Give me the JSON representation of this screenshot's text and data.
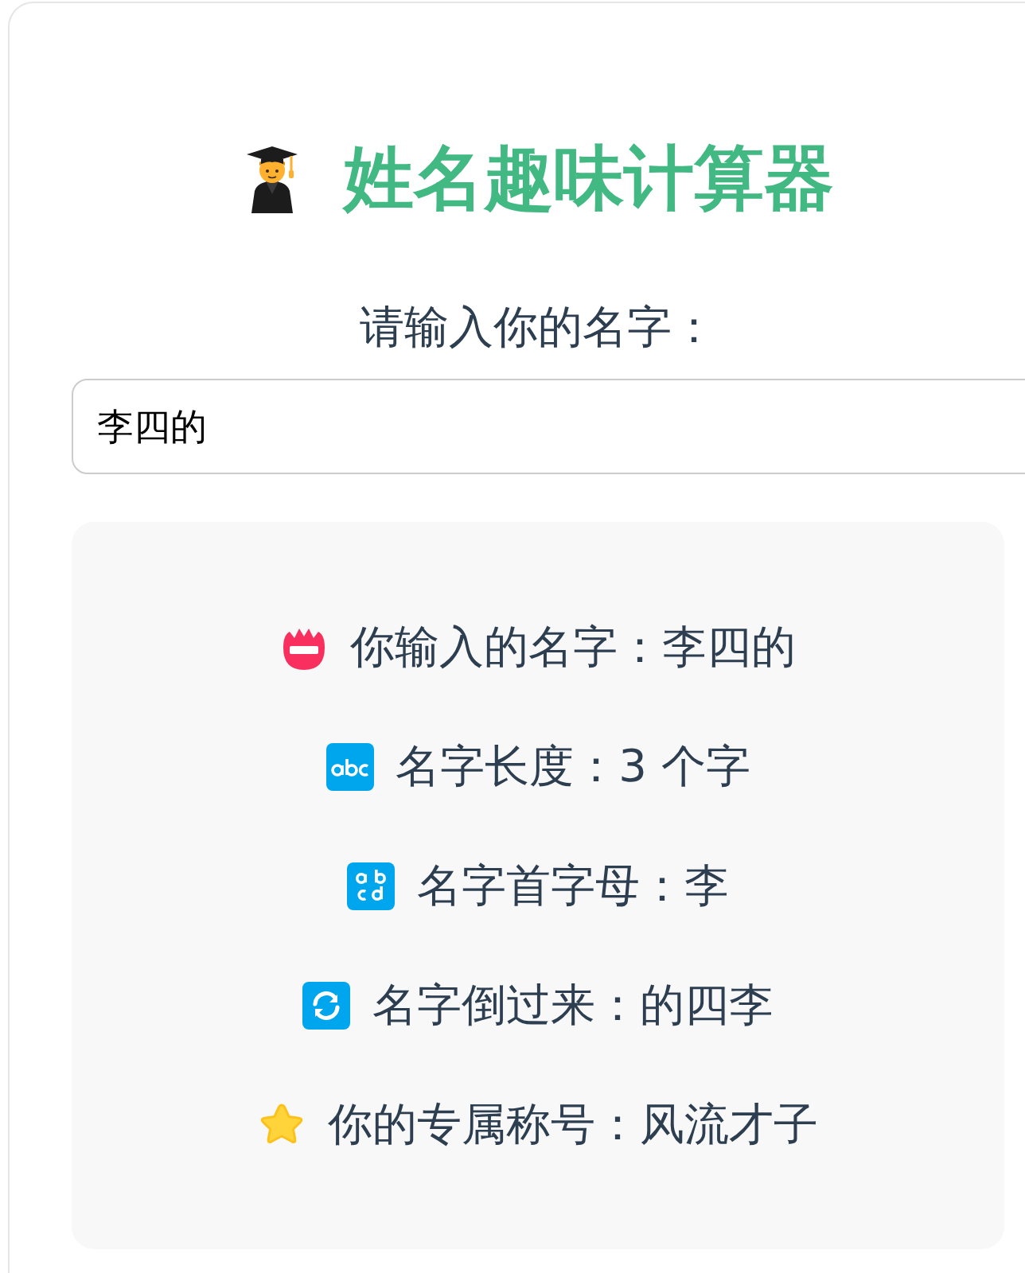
{
  "header": {
    "title": "姓名趣味计算器"
  },
  "name_field": {
    "label": "请输入你的名字：",
    "value": "李四的"
  },
  "results": [
    {
      "kind": "name",
      "label": "你输入的名字：",
      "value": "李四的"
    },
    {
      "kind": "length",
      "label": "名字长度：",
      "value": "3 个字"
    },
    {
      "kind": "initial",
      "label": "名字首字母：",
      "value": "李"
    },
    {
      "kind": "reversed",
      "label": "名字倒过来：",
      "value": "的四李"
    },
    {
      "kind": "title",
      "label": "你的专属称号：",
      "value": "风流才子"
    }
  ]
}
